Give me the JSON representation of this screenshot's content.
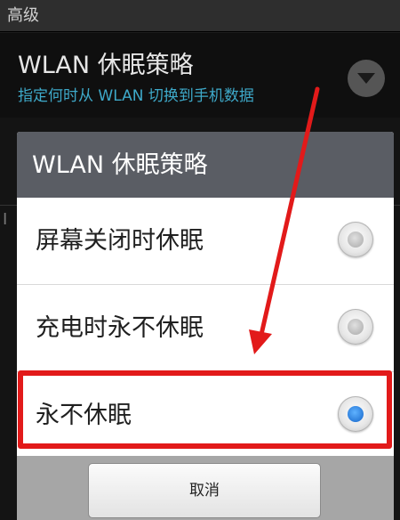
{
  "background": {
    "header_title": "高级",
    "pref_title": "WLAN 休眠策略",
    "pref_summary": "指定何时从 WLAN 切换到手机数据",
    "edge_letter": "I"
  },
  "dialog": {
    "title": "WLAN 休眠策略",
    "options": [
      {
        "label": "屏幕关闭时休眠",
        "checked": false
      },
      {
        "label": "充电时永不休眠",
        "checked": false
      },
      {
        "label": "永不休眠",
        "checked": true
      }
    ],
    "cancel_label": "取消"
  },
  "annotation": {
    "color": "#e21a1a"
  }
}
